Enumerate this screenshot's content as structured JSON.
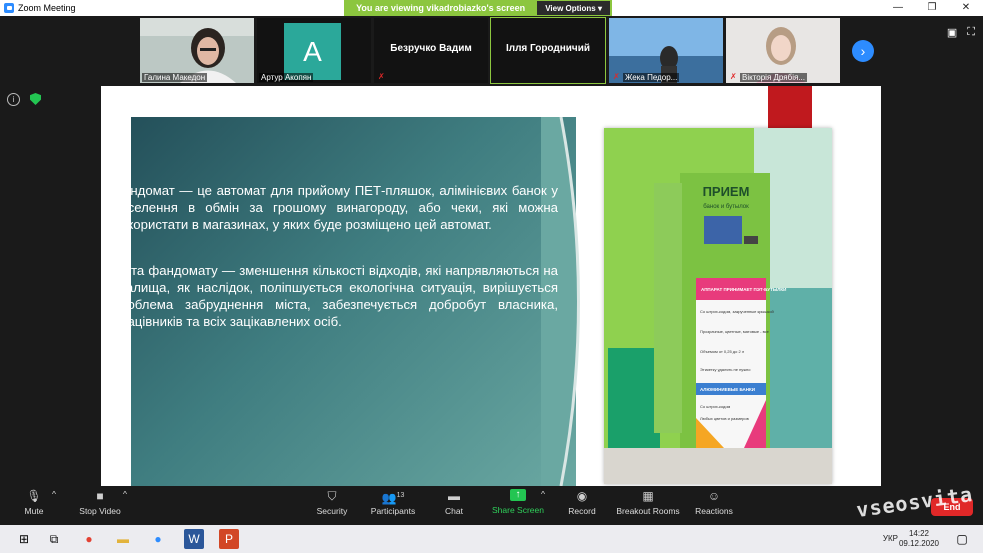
{
  "window": {
    "title": "Zoom Meeting",
    "viewing_banner": "You are viewing vikadrobiazko's screen",
    "view_options": "View Options"
  },
  "participants": [
    {
      "name": "Галина Македон",
      "type": "video"
    },
    {
      "name": "Артур Акопян",
      "type": "avatar",
      "initial": "A"
    },
    {
      "name": "Безручко Вадим",
      "type": "name-only"
    },
    {
      "name": "Ілля Городничий",
      "type": "name-only"
    },
    {
      "name": "Жека Педор...",
      "type": "video"
    },
    {
      "name": "Вікторія Дрябія...",
      "type": "video"
    }
  ],
  "slide": {
    "paragraph1": "Фандомат — це автомат для прийому ПЕТ-пляшок, алімінієвих банок у населення в обмін за грошому винагороду, або чеки, які можна використати в магазинах, у яких буде розміщено цей автомат.",
    "paragraph2": "Мета фандомату — зменшення кількості відходів, які напрявляються на звалища, як наслідок, поліпшується екологічна ситуація, вирішується проблема забруднення міста, забезпечується добробут власника, працівників та всіх зацікавлених осіб.",
    "machine_sign": "ПРИЕМ",
    "machine_sub": "банок и бутылок",
    "panel_heading": "АППАРАТ ПРИНИМАЕТ ПЭТ-БУТЫЛКИ",
    "panel_items": [
      "Со штрих-кодом, закрученные крышкой",
      "Прозрачные, цветные, матовые - все",
      "Объемом от 0,25 до 2 л",
      "Этикетку удалять не нужно"
    ],
    "panel_heading2": "АЛЮМИНИЕВЫЕ БАНКИ",
    "panel_items2": [
      "Со штрих-кодом",
      "Любых цветов и размеров"
    ]
  },
  "toolbar": {
    "mute": "Mute",
    "stop_video": "Stop Video",
    "security": "Security",
    "participants": "Participants",
    "participants_count": "13",
    "chat": "Chat",
    "share_screen": "Share Screen",
    "record": "Record",
    "breakout_rooms": "Breakout Rooms",
    "reactions": "Reactions",
    "end": "End"
  },
  "taskbar": {
    "lang": "УКР",
    "time": "14:22",
    "date": "09.12.2020"
  },
  "watermark": "vseosvita"
}
